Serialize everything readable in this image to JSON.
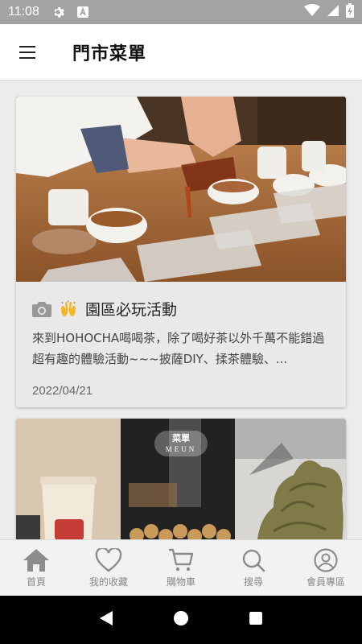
{
  "status_bar": {
    "time": "11:08"
  },
  "header": {
    "title": "門市菜單"
  },
  "cards": [
    {
      "title": "園區必玩活動",
      "description": "來到HOHOCHA喝喝茶，除了喝好茶以外千萬不能錯過超有趣的體驗活動~~~披薩DIY、揉茶體驗、...",
      "date": "2022/04/21"
    },
    {
      "overlay_title": "菜單",
      "overlay_subtitle": "MEUN"
    }
  ],
  "bottom_nav": [
    {
      "label": "首頁",
      "icon": "home-icon"
    },
    {
      "label": "我的收藏",
      "icon": "heart-icon"
    },
    {
      "label": "購物車",
      "icon": "cart-icon"
    },
    {
      "label": "搜尋",
      "icon": "search-icon"
    },
    {
      "label": "會員專區",
      "icon": "profile-icon"
    }
  ],
  "colors": {
    "status_bar": "#a3a3a3",
    "nav_icon": "#8c8c8c",
    "card_bg": "#e9e9e9"
  }
}
